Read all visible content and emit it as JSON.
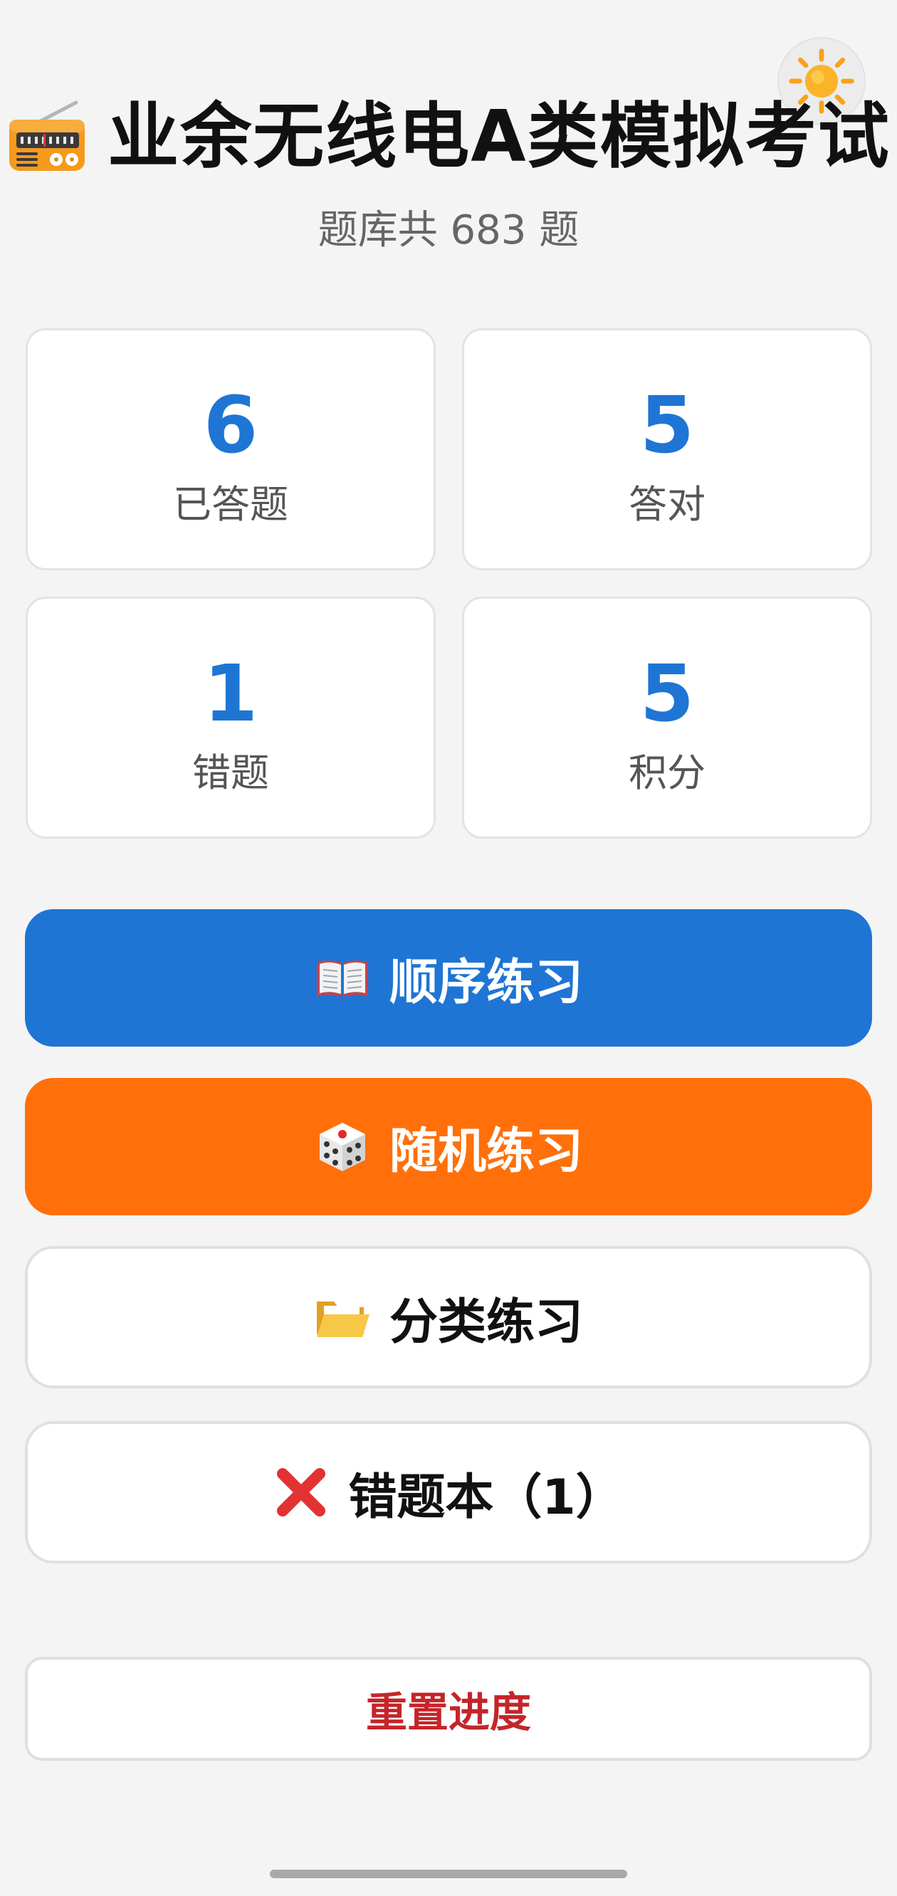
{
  "theme_toggle": {
    "icon": "sun-icon"
  },
  "header": {
    "icon": "radio-icon",
    "title": "业余无线电A类模拟考试",
    "subtitle": "题库共 683 题"
  },
  "stats": [
    {
      "value": "6",
      "label": "已答题"
    },
    {
      "value": "5",
      "label": "答对"
    },
    {
      "value": "1",
      "label": "错题"
    },
    {
      "value": "5",
      "label": "积分"
    }
  ],
  "actions": {
    "sequential": {
      "icon": "open-book-icon",
      "label": "顺序练习"
    },
    "random": {
      "icon": "dice-icon",
      "label": "随机练习"
    },
    "category": {
      "icon": "folder-icon",
      "label": "分类练习"
    },
    "wrong_book": {
      "icon": "cross-mark-icon",
      "label": "错题本（1）"
    },
    "reset": {
      "label": "重置进度"
    }
  },
  "colors": {
    "accent_blue": "#1e75d4",
    "accent_orange": "#ff700a",
    "danger_red": "#c4252a",
    "background": "#f4f4f4"
  }
}
